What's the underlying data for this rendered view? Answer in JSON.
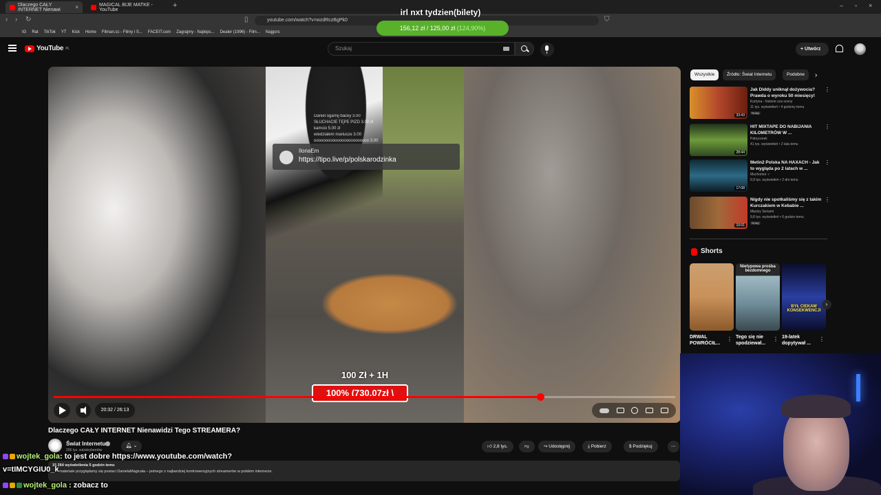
{
  "browser": {
    "tabs": [
      {
        "title": "Dlaczego CAŁY INTERNET Nienawi",
        "active": true
      },
      {
        "title": "MAGICAL BIJE MATKE - YouTube",
        "active": false
      }
    ],
    "url": "youtube.com/watch?v=wzdRczBgPk0",
    "bookmarks": [
      "IG",
      "Rat",
      "TikTok",
      "YT",
      "Kick",
      "Home",
      "",
      "Filman.cc - Filmy i S...",
      "FACEIT.com",
      "Zagrajmy - Najleps...",
      "Dealer (1996) - Film...",
      "Najgors"
    ]
  },
  "goal": {
    "title": "irl nxt tydzien(bilety)",
    "amount": "156,12 zł / 125,00 zł",
    "percent": "(124,90%)"
  },
  "header": {
    "logo": "YouTube",
    "region": "PL",
    "search_placeholder": "Szukaj",
    "create_label": "Utwórz"
  },
  "video": {
    "overlay_lines": [
      "Daniel ogarnij bacey   3.00",
      "SŁUCHACIE TĘPE PIZD   3.00 zł",
      "kamcio  5.00 zł",
      "wiedziałem mariusze   3.00",
      "oooooooooooooooooooooooo   3.00"
    ],
    "tipo_user": "IlonaEm",
    "tipo_link": "https://tipo.live/p/polskarodzinka",
    "promo_line1": "100 Zł + 1H",
    "promo_line2": "100% (730.07zł \\",
    "time": "20:32 / 26:13",
    "progress": 0.783,
    "title": "Dlaczego CAŁY INTERNET Nienawidzi Tego STREAMERA?",
    "channel": "Świat Internetu",
    "subscribers": "206 tys. subskrybentów",
    "likes": "2,8 tys.",
    "share": "Udostępnij",
    "download": "Pobierz",
    "thanks": "Podziękuj",
    "description_meta": "15 264 wyświetlenia  5 godzin temu",
    "description_text": "materiale przyglądamy się postaci DanielaMagicala – jednego z najbardziej kontrowersyjnych streamerów w polskim internecie."
  },
  "chat": [
    {
      "user": "wojtek_gola",
      "text": ": to jest dobre https://www.youtube.com/watch?"
    },
    {
      "user": "",
      "text": "v=tIMCYGIU0_k"
    },
    {
      "user": "wojtek_gola",
      "text": ": zobacz to"
    }
  ],
  "sidebar": {
    "chips": [
      "Wszystkie",
      "Źródło: Świat Internetu",
      "Podobne"
    ],
    "recommendations": [
      {
        "title": "Jak Diddy uniknął dożywocia? Prawda o wyroku 50 miesięcy!",
        "channel": "Kurtyna - historie zza sceny",
        "meta": "11 tys. wyświetleń • 4 godziny temu",
        "badge": "Nowy",
        "duration": "33:43",
        "color": "#b3472c"
      },
      {
        "title": "HIT MIXTAPE DO NABIJANIA KILOMETRÓW W ...",
        "channel": "Patryczeek",
        "meta": "41 tys. wyświetleń • 2 lata temu",
        "badge": "",
        "duration": "28:44",
        "color": "#6d9a3a"
      },
      {
        "title": "Metin2 Polska NA HAXACH - Jak to wygląda po 2 latach w ...",
        "channel": "Muchomor ✓",
        "meta": "9,9 tys. wyświetleń • 2 dni temu",
        "badge": "Nowy",
        "duration": "17:08",
        "color": "#2d6a86"
      },
      {
        "title": "Nigdy nie spotkaliśmy się z takim Kurczakiem w Kebabie ...",
        "channel": "Między Seriami",
        "meta": "9,8 tys. wyświetleń • 6 godzin temu",
        "badge": "Nowy",
        "duration": "10:01",
        "color": "#a06a3a"
      }
    ],
    "shorts_title": "Shorts",
    "shorts": [
      {
        "title": "DRWAL POWRÓCIŁ...",
        "caption": "",
        "color": "#c9905a"
      },
      {
        "title": "Tego się nie spodziewał...",
        "caption": "Nietypowa prośba bezdomnego",
        "color": "#6f8d9a"
      },
      {
        "title": "19-latek dopytywał ...",
        "caption": "BYŁ CIEKAW KONSEKWENCJI",
        "color": "#2a3fa0"
      }
    ]
  }
}
